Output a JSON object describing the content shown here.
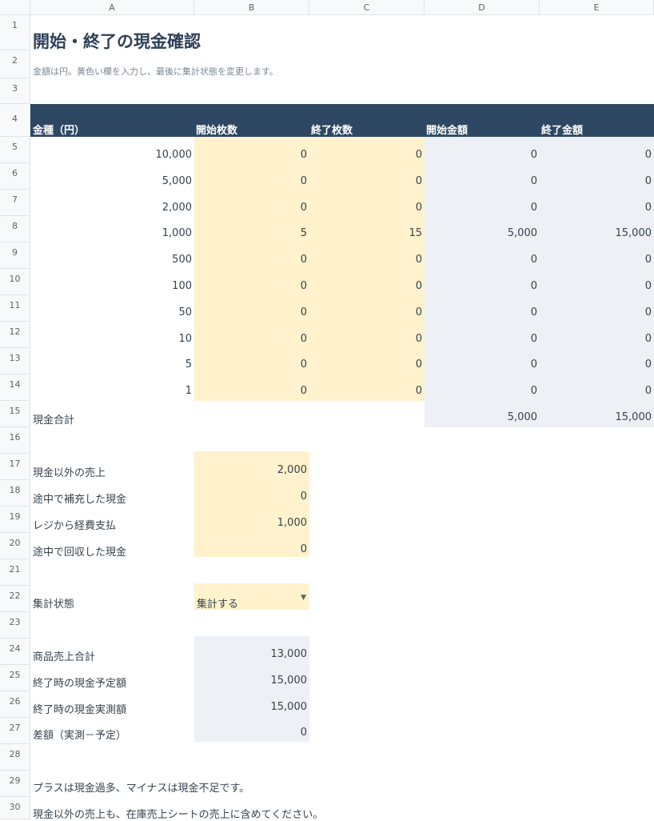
{
  "columns": [
    "A",
    "B",
    "C",
    "D",
    "E"
  ],
  "rows": [
    "1",
    "2",
    "3",
    "4",
    "5",
    "6",
    "7",
    "8",
    "9",
    "10",
    "11",
    "12",
    "13",
    "14",
    "15",
    "16",
    "17",
    "18",
    "19",
    "20",
    "21",
    "22",
    "23",
    "24",
    "25",
    "26",
    "27",
    "28",
    "29",
    "30"
  ],
  "title": "開始・終了の現金確認",
  "subtitle": "金額は円。黄色い欄を入力し、最後に集計状態を変更します。",
  "table_headers": [
    "金種（円）",
    "開始枚数",
    "終了枚数",
    "開始金額",
    "終了金額"
  ],
  "denominations": [
    {
      "denom": "10,000",
      "start_count": "0",
      "end_count": "0",
      "start_amount": "0",
      "end_amount": "0"
    },
    {
      "denom": "5,000",
      "start_count": "0",
      "end_count": "0",
      "start_amount": "0",
      "end_amount": "0"
    },
    {
      "denom": "2,000",
      "start_count": "0",
      "end_count": "0",
      "start_amount": "0",
      "end_amount": "0"
    },
    {
      "denom": "1,000",
      "start_count": "5",
      "end_count": "15",
      "start_amount": "5,000",
      "end_amount": "15,000"
    },
    {
      "denom": "500",
      "start_count": "0",
      "end_count": "0",
      "start_amount": "0",
      "end_amount": "0"
    },
    {
      "denom": "100",
      "start_count": "0",
      "end_count": "0",
      "start_amount": "0",
      "end_amount": "0"
    },
    {
      "denom": "50",
      "start_count": "0",
      "end_count": "0",
      "start_amount": "0",
      "end_amount": "0"
    },
    {
      "denom": "10",
      "start_count": "0",
      "end_count": "0",
      "start_amount": "0",
      "end_amount": "0"
    },
    {
      "denom": "5",
      "start_count": "0",
      "end_count": "0",
      "start_amount": "0",
      "end_amount": "0"
    },
    {
      "denom": "1",
      "start_count": "0",
      "end_count": "0",
      "start_amount": "0",
      "end_amount": "0"
    }
  ],
  "cash_total": {
    "label": "現金合計",
    "start": "5,000",
    "end": "15,000"
  },
  "adjustments": [
    {
      "label": "現金以外の売上",
      "value": "2,000"
    },
    {
      "label": "途中で補充した現金",
      "value": "0"
    },
    {
      "label": "レジから経費支払",
      "value": "1,000"
    },
    {
      "label": "途中で回収した現金",
      "value": "0"
    }
  ],
  "status": {
    "label": "集計状態",
    "value": "集計する"
  },
  "results": [
    {
      "label": "商品売上合計",
      "value": "13,000"
    },
    {
      "label": "終了時の現金予定額",
      "value": "15,000"
    },
    {
      "label": "終了時の現金実測額",
      "value": "15,000"
    },
    {
      "label": "差額（実測－予定）",
      "value": "0"
    }
  ],
  "notes": [
    "プラスは現金過多、マイナスは現金不足です。",
    "現金以外の売上も、在庫売上シートの売上に含めてください。"
  ],
  "colors": {
    "header": "#2e4863",
    "input": "#fff2cc",
    "computed": "#edf0f5"
  }
}
